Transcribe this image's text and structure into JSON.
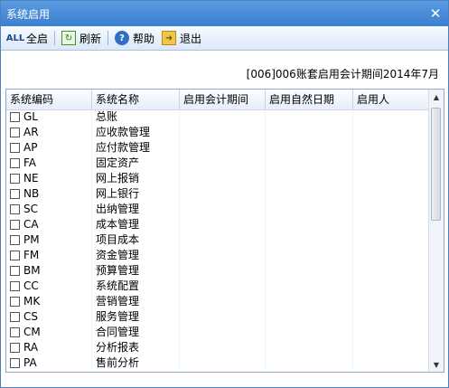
{
  "window": {
    "title": "系统启用",
    "close_symbol": "✕"
  },
  "toolbar": {
    "all_label": "全启",
    "refresh_label": "刷新",
    "help_label": "帮助",
    "exit_label": "退出",
    "all_icon_text": "ALL"
  },
  "period_text": "[006]006账套启用会计期间2014年7月",
  "columns": [
    "系统编码",
    "系统名称",
    "启用会计期间",
    "启用自然日期",
    "启用人"
  ],
  "rows": [
    {
      "code": "GL",
      "name": "总账"
    },
    {
      "code": "AR",
      "name": "应收款管理"
    },
    {
      "code": "AP",
      "name": "应付款管理"
    },
    {
      "code": "FA",
      "name": "固定资产"
    },
    {
      "code": "NE",
      "name": "网上报销"
    },
    {
      "code": "NB",
      "name": "网上银行"
    },
    {
      "code": "SC",
      "name": "出纳管理"
    },
    {
      "code": "CA",
      "name": "成本管理"
    },
    {
      "code": "PM",
      "name": "项目成本"
    },
    {
      "code": "FM",
      "name": "资金管理"
    },
    {
      "code": "BM",
      "name": "预算管理"
    },
    {
      "code": "CC",
      "name": "系统配置"
    },
    {
      "code": "MK",
      "name": "营销管理"
    },
    {
      "code": "CS",
      "name": "服务管理"
    },
    {
      "code": "CM",
      "name": "合同管理"
    },
    {
      "code": "RA",
      "name": "分析报表"
    },
    {
      "code": "PA",
      "name": "售前分析"
    }
  ]
}
